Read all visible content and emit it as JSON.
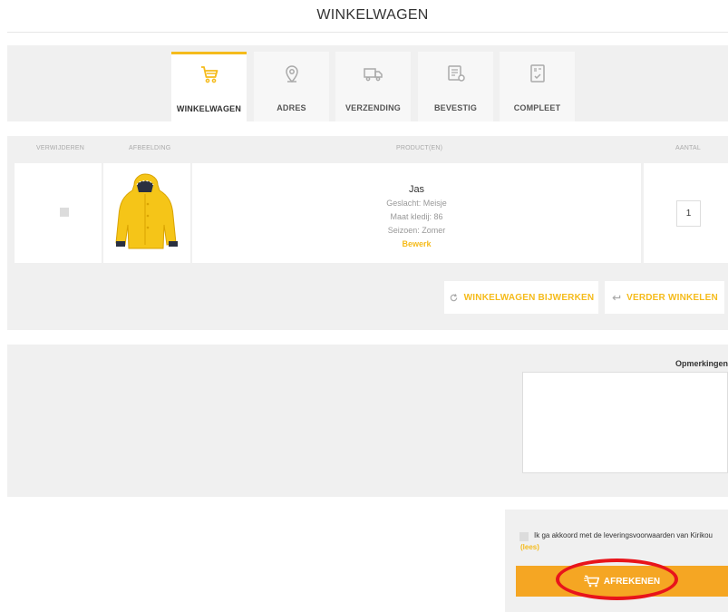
{
  "page": {
    "title": "WINKELWAGEN"
  },
  "steps": [
    {
      "label": "WINKELWAGEN",
      "icon": "cart-icon",
      "active": true
    },
    {
      "label": "ADRES",
      "icon": "location-pin-icon",
      "active": false
    },
    {
      "label": "VERZENDING",
      "icon": "truck-icon",
      "active": false
    },
    {
      "label": "BEVESTIG",
      "icon": "receipt-icon",
      "active": false
    },
    {
      "label": "COMPLEET",
      "icon": "document-check-icon",
      "active": false
    }
  ],
  "cart": {
    "headers": {
      "remove": "VERWIJDEREN",
      "image": "AFBEELDING",
      "product": "PRODUCT(EN)",
      "quantity": "AANTAL"
    },
    "items": [
      {
        "name": "Jas",
        "attributes": [
          "Geslacht: Meisje",
          "Maat kledij: 86",
          "Seizoen: Zomer"
        ],
        "edit_label": "Bewerk",
        "quantity": "1",
        "image": "yellow-raincoat-image"
      }
    ],
    "update_button": "WINKELWAGEN BIJWERKEN",
    "continue_button": "VERDER WINKELEN"
  },
  "remarks": {
    "label": "Opmerkingen",
    "value": ""
  },
  "checkout": {
    "terms_text": "Ik ga akkoord met de leveringsvoorwaarden van Kirikou",
    "terms_link": "(lees)",
    "button_label": "AFREKENEN"
  },
  "colors": {
    "accent": "#f5bb1b",
    "checkout": "#f5a623",
    "highlight": "#e8141b",
    "panel": "#f0f0f0"
  }
}
